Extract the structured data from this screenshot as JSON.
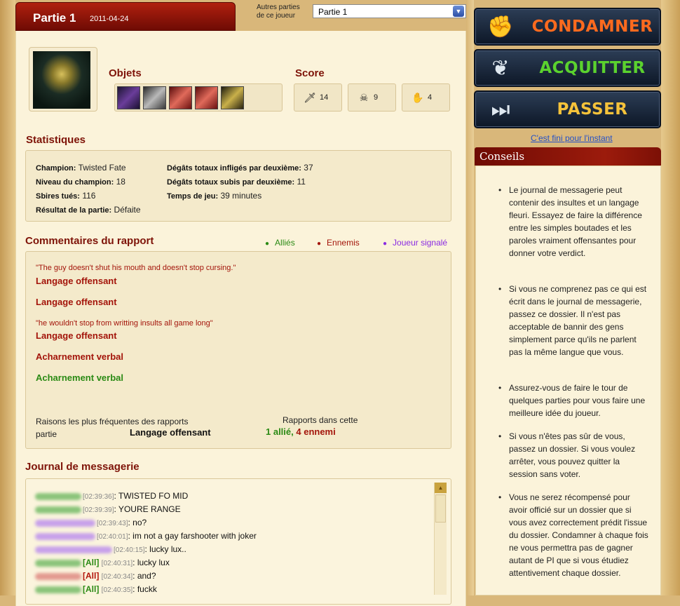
{
  "header": {
    "title": "Partie  1",
    "date": "2011-04-24"
  },
  "other_games": {
    "label": "Autres parties de ce joueur",
    "selected": "Partie 1"
  },
  "sections": {
    "objects": "Objets",
    "score": "Score",
    "stats": "Statistiques",
    "comments": "Commentaires du rapport",
    "journal": "Journal de messagerie"
  },
  "score": {
    "kills": "14",
    "deaths": "9",
    "assists": "4"
  },
  "stats": {
    "champion_label": "Champion:",
    "champion": "Twisted Fate",
    "level_label": "Niveau du champion:",
    "level": "18",
    "minions_label": "Sbires tués:",
    "minions": "116",
    "result_label": "Résultat de la partie:",
    "result": "Défaite",
    "dealt_label": "Dégâts totaux infligés par deuxième:",
    "dealt": "37",
    "taken_label": "Dégâts totaux subis par deuxième:",
    "taken": "11",
    "time_label": "Temps de jeu:",
    "time": "39 minutes"
  },
  "legend": {
    "allies": "Alliés",
    "enemies": "Ennemis",
    "reported": "Joueur signalé"
  },
  "colors": {
    "allies": "#2a8a14",
    "enemies": "#a3140a",
    "reported": "#8a2be2"
  },
  "reports": [
    {
      "comment": "\"The guy doesn't shut his mouth and doesn't stop cursing.\"",
      "reason": "Langage offensant",
      "color": "red"
    },
    {
      "comment": "",
      "reason": "Langage offensant",
      "color": "red"
    },
    {
      "comment": "\"he wouldn't stop from writting insults all game long\"",
      "reason": "Langage offensant",
      "color": "red"
    },
    {
      "comment": "",
      "reason": "Acharnement verbal",
      "color": "red"
    },
    {
      "comment": "",
      "reason": "Acharnement verbal",
      "color": "green"
    }
  ],
  "summary": {
    "frequent_label": "Raisons les plus fréquentes des rapports partie",
    "frequent_value": "Langage offensant",
    "count_label": "Rapports dans cette",
    "count_ally": "1 allié,",
    "count_enemy": "4 ennemi"
  },
  "chat": [
    {
      "time": "[02:39:36]",
      "tag": "",
      "text": ": TWISTED FO MID",
      "who": "ally"
    },
    {
      "time": "[02:39:39]",
      "tag": "",
      "text": ": YOURE RANGE",
      "who": "ally"
    },
    {
      "time": "[02:39:43]",
      "tag": "",
      "text": ": no?",
      "who": "reported"
    },
    {
      "time": "[02:40:01]",
      "tag": "",
      "text": ": im not a gay farshooter with joker",
      "who": "reported"
    },
    {
      "time": "[02:40:15]",
      "tag": "",
      "text": ": lucky lux..",
      "who": "reported"
    },
    {
      "time": "[02:40:31]",
      "tag": "[All]",
      "text": ": lucky lux",
      "who": "ally"
    },
    {
      "time": "[02:40:34]",
      "tag": "[All]",
      "text": ": and?",
      "who": "enemy"
    },
    {
      "time": "[02:40:35]",
      "tag": "[All]",
      "text": ": fuckk",
      "who": "ally"
    }
  ],
  "actions": {
    "condemn": "CONDAMNER",
    "acquit": "ACQUITTER",
    "skip": "PASSER",
    "done": "C'est fini pour l'instant"
  },
  "tips_title": "Conseils",
  "tips": [
    "Le journal de messagerie peut contenir des insultes et un langage fleuri. Essayez de faire la différence entre les simples boutades et les paroles vraiment offensantes pour donner votre verdict.",
    "Si vous ne comprenez pas ce qui est écrit dans le journal de messagerie, passez ce dossier. Il n'est pas acceptable de bannir des gens simplement parce qu'ils ne parlent pas la même langue que vous.",
    "Assurez-vous de faire le tour de quelques parties pour vous faire une meilleure idée du joueur.",
    "Si vous n'êtes pas sûr de vous, passez un dossier. Si vous voulez arrêter, vous pouvez quitter la session sans voter.",
    "Vous ne serez récompensé pour avoir officié sur un dossier que si vous avez correctement prédit l'issue du dossier. Condamner à chaque fois ne vous permettra pas de gagner autant de PI que si vous étudiez attentivement chaque dossier."
  ]
}
